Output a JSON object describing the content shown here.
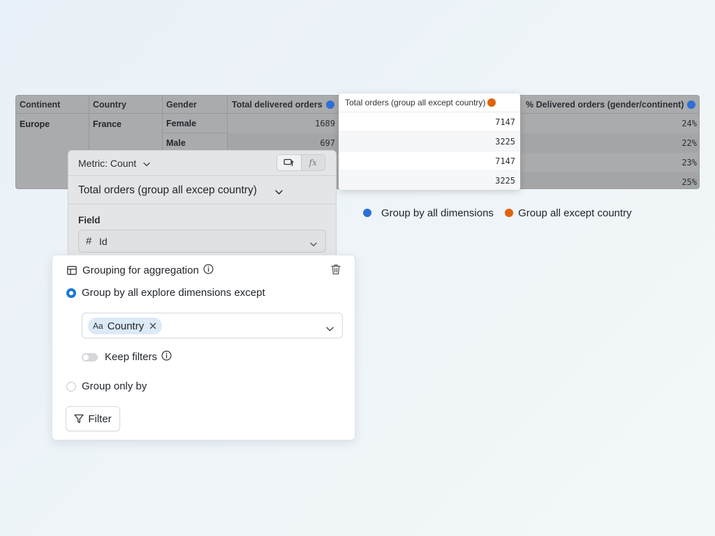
{
  "colors": {
    "blue_dot": "#2e6fd6",
    "orange_dot": "#e0620d",
    "radio_accent": "#1f78d1",
    "chip_bg": "#dce9f7"
  },
  "table": {
    "headers": {
      "continent": "Continent",
      "country": "Country",
      "gender": "Gender",
      "total_delivered": "Total delivered orders",
      "total_orders_group": "Total orders (group all except country)",
      "pct_delivered": "% Delivered orders (gender/continent)"
    },
    "continent_value": "Europe",
    "country_value": "France",
    "genders": [
      "Female",
      "Male"
    ],
    "total_delivered": [
      "1689",
      "697"
    ],
    "total_orders_group": [
      "7147",
      "3225",
      "7147",
      "3225"
    ],
    "pct_delivered": [
      "24%",
      "22%",
      "23%",
      "25%"
    ]
  },
  "legend": {
    "blue_label": "Group by all dimensions",
    "orange_label": "Group all except country"
  },
  "metric_panel": {
    "metric_label": "Metric: Count",
    "title": "Total orders (group all excep country)",
    "field_label": "Field",
    "field_value": "Id",
    "field_icon": "hash-icon",
    "formula_symbol": "fx"
  },
  "grouping_panel": {
    "title": "Grouping for aggregation",
    "option_except": "Group by all explore dimensions except",
    "selected_dimension": "Country",
    "dimension_type_icon": "Aa",
    "keep_filters_label": "Keep filters",
    "keep_filters_on": false,
    "option_only": "Group only by",
    "filter_button": "Filter"
  }
}
